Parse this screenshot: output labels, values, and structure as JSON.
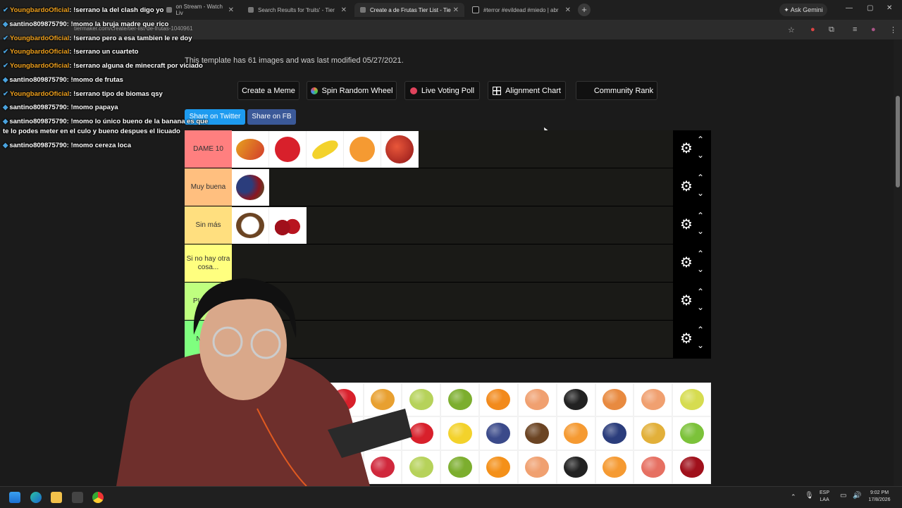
{
  "browser": {
    "tabs": [
      {
        "label": "on Stream - Watch Liv",
        "active": false
      },
      {
        "label": "Search Results for 'fruits' - Tier",
        "active": false
      },
      {
        "label": "Create a de Frutas Tier List - Tie",
        "active": true
      },
      {
        "label": "#terror #evildead #miedo | abr",
        "active": false
      }
    ],
    "ask_gemini": "Ask Gemini",
    "url": "tiermaker.com/create/tier-list-de-frutas-1040961"
  },
  "page": {
    "template_info": "This template has 61 images and was last modified 05/27/2021.",
    "buttons": {
      "create_meme": "Create a Meme",
      "spin_wheel": "Spin Random Wheel",
      "live_poll": "Live Voting Poll",
      "alignment": "Alignment Chart",
      "community": "Community Rank"
    },
    "share_twitter": "Share on Twitter",
    "share_fb": "Share on FB"
  },
  "tiers": [
    {
      "label": "DAME 10",
      "color": "#ff7f7f",
      "items": [
        "mango",
        "strawberry",
        "banana",
        "apricot",
        "nectarine"
      ]
    },
    {
      "label": "Muy buena",
      "color": "#ffbf7f",
      "items": [
        "berries"
      ]
    },
    {
      "label": "Sin más",
      "color": "#ffdf7f",
      "items": [
        "coconut",
        "cherries"
      ]
    },
    {
      "label": "Si no hay otra cosa...",
      "color": "#ffff7f",
      "items": []
    },
    {
      "label": "PUTO AS",
      "color": "#bfff7f",
      "items": []
    },
    {
      "label": "No sé c",
      "color": "#7fff7f",
      "items": []
    }
  ],
  "pool": [
    "raspberry",
    "strawberry",
    "mixed-fruit",
    "grapes-green",
    "kiwi",
    "tangerine",
    "peach",
    "blackberry",
    "papaya",
    "peach",
    "pear",
    "apple-red",
    "grapes-purple",
    "melon",
    "strawberry",
    "banana",
    "plum",
    "coconut",
    "apricot",
    "blueberries",
    "pineapple",
    "lime",
    "mango",
    "fig",
    "raspberry",
    "grapes-green",
    "kiwi",
    "orange",
    "peach",
    "blackberry",
    "apricot",
    "lychee",
    "cherry"
  ],
  "chat": [
    {
      "user": "YoungbardoOficial",
      "text": "!serrano la del clash digo yo",
      "type": "y"
    },
    {
      "user": "santino809875790",
      "text": "!momo la bruja madre que rico",
      "type": "s"
    },
    {
      "user": "YoungbardoOficial",
      "text": "!serrano pero a esa tambien le re doy",
      "type": "y"
    },
    {
      "user": "YoungbardoOficial",
      "text": "!serrano un cuarteto",
      "type": "y"
    },
    {
      "user": "YoungbardoOficial",
      "text": "!serrano alguna de minecraft por viciado",
      "type": "y"
    },
    {
      "user": "santino809875790",
      "text": "!momo de frutas",
      "type": "s"
    },
    {
      "user": "YoungbardoOficial",
      "text": "!serrano tipo de biomas qsy",
      "type": "y"
    },
    {
      "user": "santino809875790",
      "text": "!momo papaya",
      "type": "s"
    },
    {
      "user": "santino809875790",
      "text": "!momo lo único bueno de la banana es que te lo podes meter en el culo y bueno despues el licuado",
      "type": "s"
    },
    {
      "user": "santino809875790",
      "text": "!momo cereza loca",
      "type": "s"
    }
  ],
  "taskbar": {
    "lang": "ESP",
    "region": "LAA",
    "time": "9:02 PM",
    "date": "17/8/2026"
  }
}
